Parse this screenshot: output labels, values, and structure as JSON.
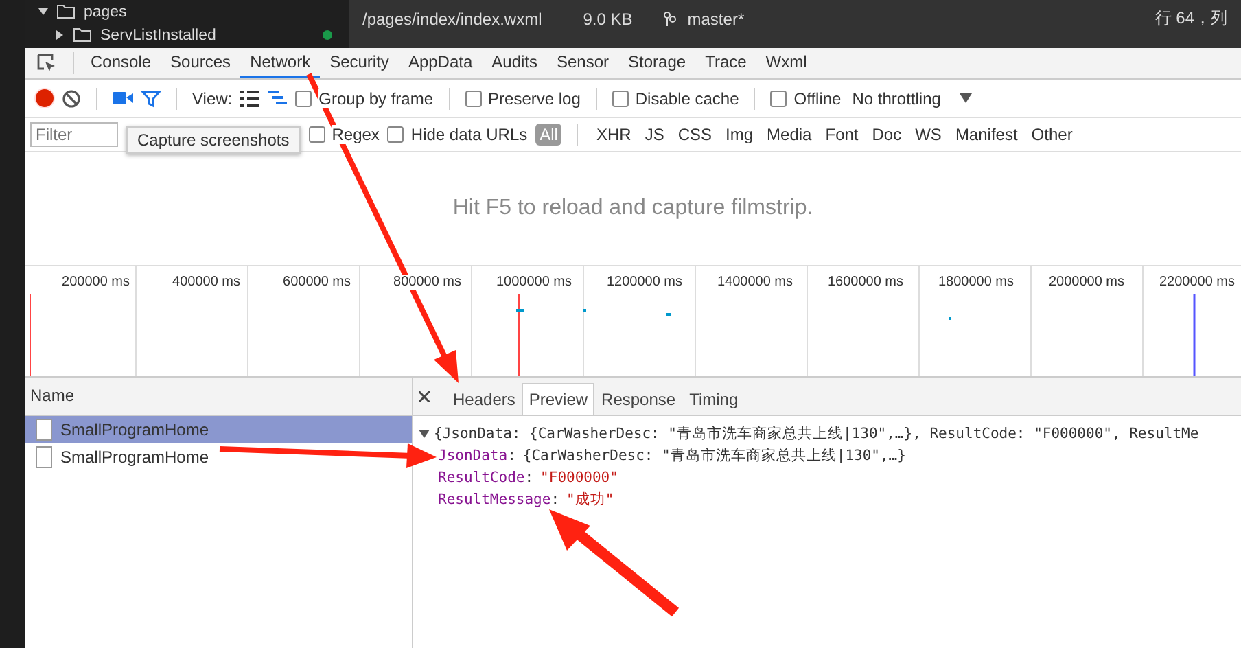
{
  "editor": {
    "tree": [
      {
        "label": "pages",
        "expanded": true
      },
      {
        "label": "ServListInstalled",
        "expanded": false,
        "modified": true
      }
    ],
    "file": {
      "path": "/pages/index/index.wxml",
      "size": "9.0 KB",
      "branch": "master*"
    },
    "cursor": "行 64，列"
  },
  "tabs": [
    {
      "label": "Console",
      "selected": false
    },
    {
      "label": "Sources",
      "selected": false
    },
    {
      "label": "Network",
      "selected": true
    },
    {
      "label": "Security",
      "selected": false
    },
    {
      "label": "AppData",
      "selected": false
    },
    {
      "label": "Audits",
      "selected": false
    },
    {
      "label": "Sensor",
      "selected": false
    },
    {
      "label": "Storage",
      "selected": false
    },
    {
      "label": "Trace",
      "selected": false
    },
    {
      "label": "Wxml",
      "selected": false
    }
  ],
  "toolbar": {
    "recording": true,
    "view_label": "View:",
    "options": [
      {
        "label": "Group by frame",
        "checked": false
      },
      {
        "label": "Preserve log",
        "checked": false
      },
      {
        "label": "Disable cache",
        "checked": false
      },
      {
        "label": "Offline",
        "checked": false
      }
    ],
    "throttling": "No throttling"
  },
  "filter": {
    "placeholder": "Filter",
    "regex": {
      "label": "Regex",
      "checked": false
    },
    "hide_data_urls": {
      "label": "Hide data URLs",
      "checked": false
    },
    "types": [
      {
        "label": "All",
        "selected": true
      },
      {
        "label": "XHR",
        "selected": false
      },
      {
        "label": "JS",
        "selected": false
      },
      {
        "label": "CSS",
        "selected": false
      },
      {
        "label": "Img",
        "selected": false
      },
      {
        "label": "Media",
        "selected": false
      },
      {
        "label": "Font",
        "selected": false
      },
      {
        "label": "Doc",
        "selected": false
      },
      {
        "label": "WS",
        "selected": false
      },
      {
        "label": "Manifest",
        "selected": false
      },
      {
        "label": "Other",
        "selected": false
      }
    ]
  },
  "tooltip": "Capture screenshots",
  "filmstrip_message": "Hit F5 to reload and capture filmstrip.",
  "timeline_ticks": [
    "200000 ms",
    "400000 ms",
    "600000 ms",
    "800000 ms",
    "1000000 ms",
    "1200000 ms",
    "1400000 ms",
    "1600000 ms",
    "1800000 ms",
    "2000000 ms",
    "2200000 ms"
  ],
  "requests_header": "Name",
  "requests": [
    {
      "name": "SmallProgramHome",
      "selected": true
    },
    {
      "name": "SmallProgramHome",
      "selected": false
    }
  ],
  "detail_tabs": [
    {
      "label": "Headers",
      "selected": false
    },
    {
      "label": "Preview",
      "selected": true
    },
    {
      "label": "Response",
      "selected": false
    },
    {
      "label": "Timing",
      "selected": false
    }
  ],
  "preview": {
    "expanded": true,
    "summary": "{JsonData: {CarWasherDesc: \"青岛市洗车商家总共上线|130\",…}, ResultCode: \"F000000\", ResultMe",
    "children": [
      {
        "key": "JsonData",
        "value": "{CarWasherDesc: \"青岛市洗车商家总共上线|130\",…}",
        "kind": "object",
        "expanded": false,
        "separator": ":"
      },
      {
        "key": "ResultCode",
        "value": "\"F000000\"",
        "kind": "string",
        "separator": ":"
      },
      {
        "key": "ResultMessage",
        "value": "\"成功\"",
        "kind": "string",
        "separator": ":"
      }
    ]
  }
}
